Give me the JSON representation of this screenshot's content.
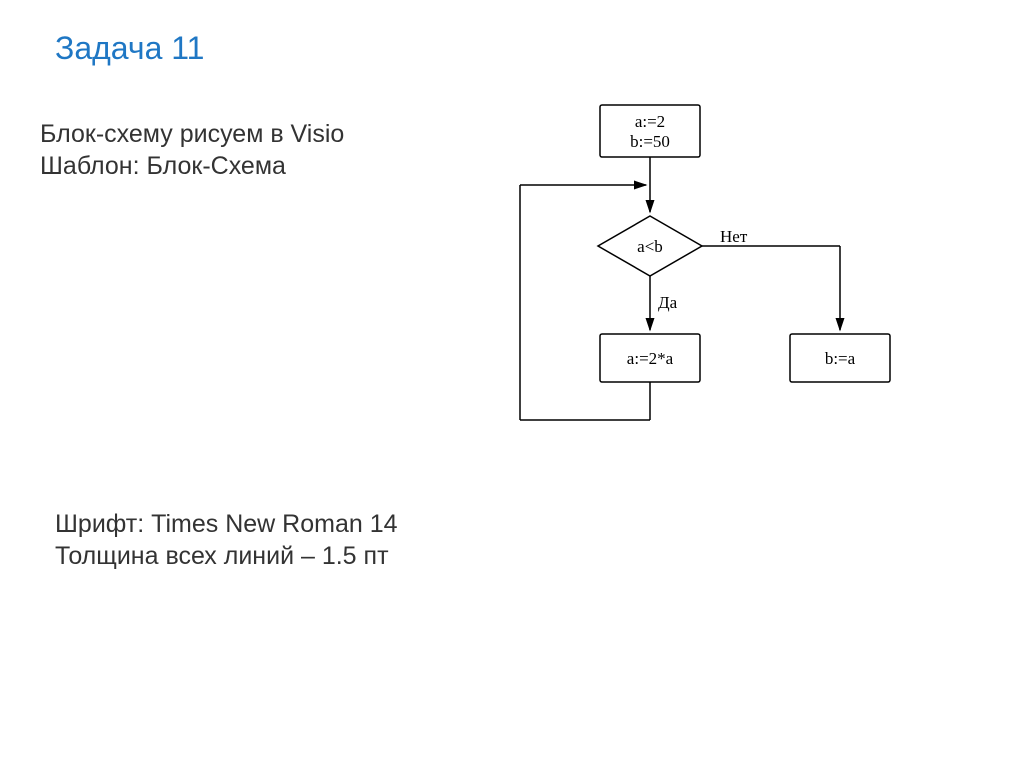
{
  "title": "Задача 11",
  "instruction": {
    "line1": "Блок-схему рисуем в Visio",
    "line2": "Шаблон: Блок-Схема"
  },
  "notes": {
    "line1": "Шрифт: Times New Roman 14",
    "line2": "Толщина всех линий – 1.5 пт"
  },
  "flowchart": {
    "init": {
      "line1": "a:=2",
      "line2": "b:=50"
    },
    "condition": "a<b",
    "yes_label": "Да",
    "no_label": "Нет",
    "yes_action": "a:=2*a",
    "no_action": "b:=a"
  }
}
